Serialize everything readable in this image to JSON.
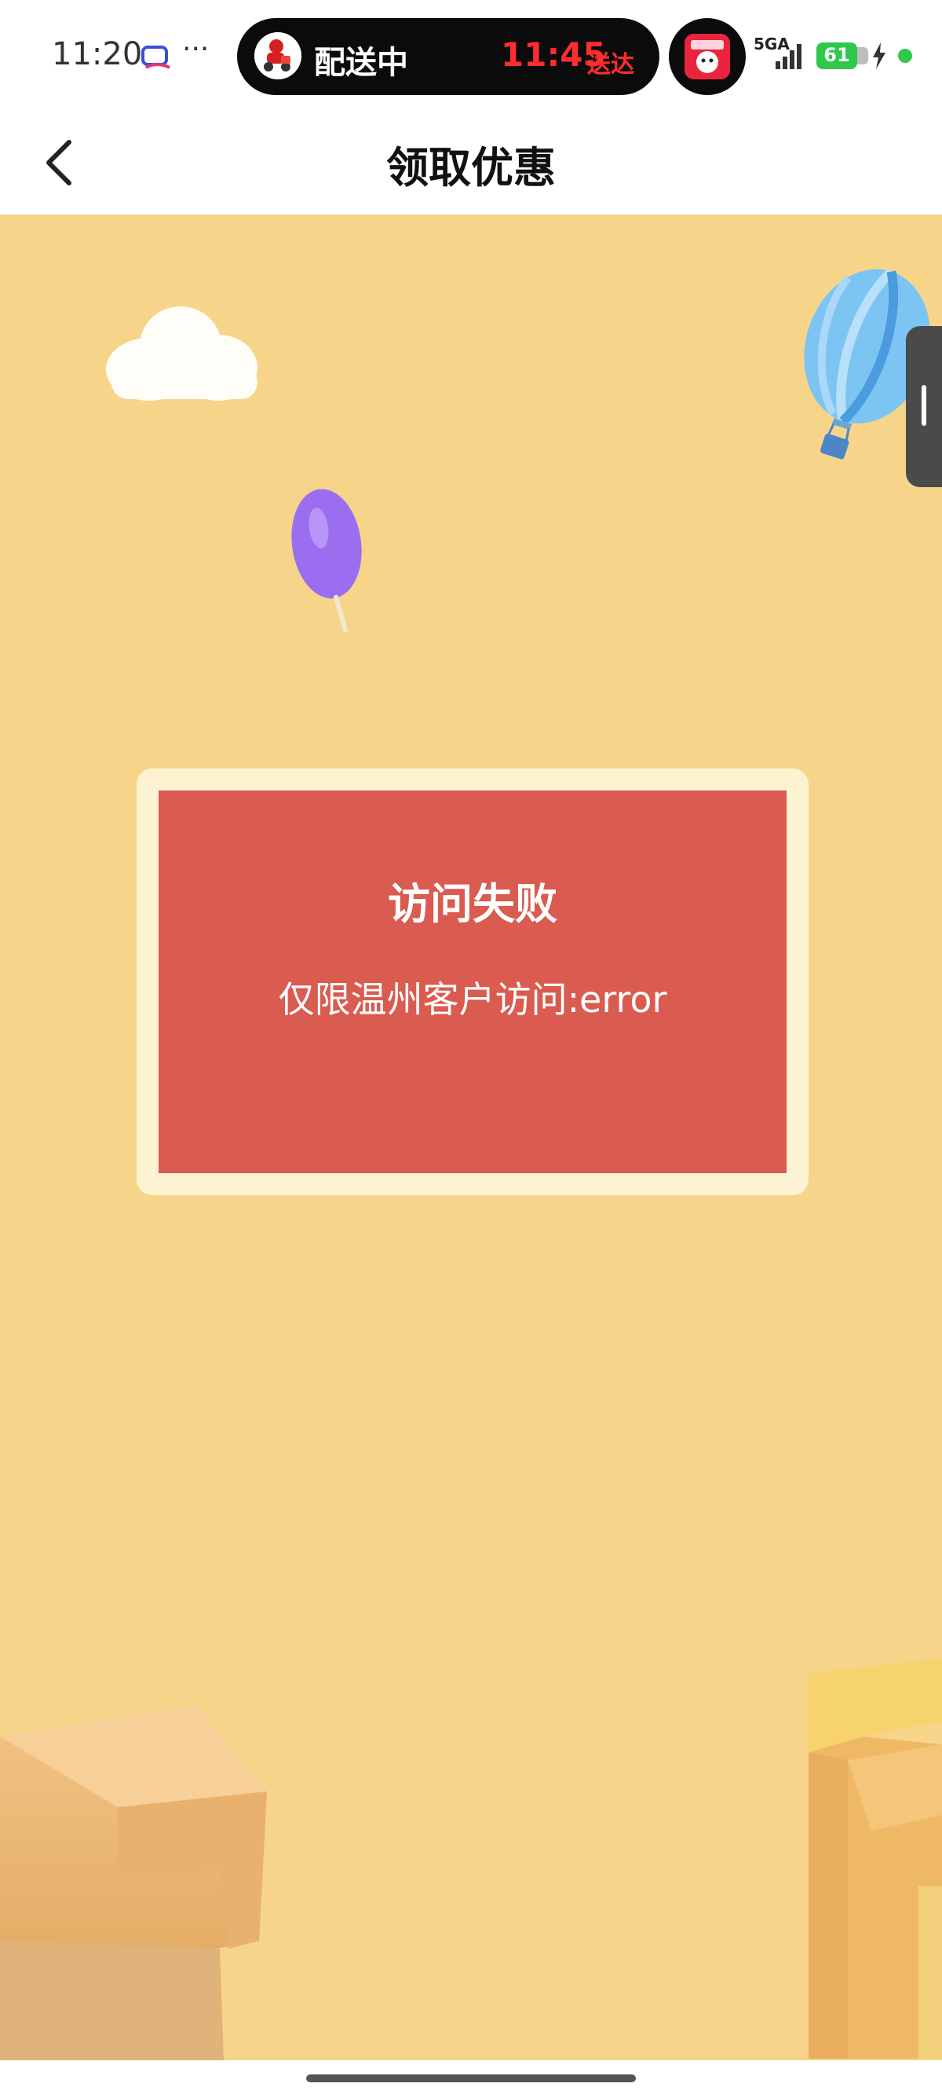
{
  "status_bar": {
    "time": "11:20",
    "more": "···",
    "delivery_status": "配送中",
    "delivery_time": "11:45",
    "delivery_suffix": "送达",
    "network": "5GA",
    "battery": "61"
  },
  "nav": {
    "title": "领取优惠"
  },
  "card": {
    "title": "访问失败",
    "message": "仅限温州客户访问:error"
  },
  "colors": {
    "background": "#f6d58a",
    "card_red": "#da5b4f",
    "card_frame": "#fdf3d2",
    "delivery_red": "#ff2d2d"
  }
}
